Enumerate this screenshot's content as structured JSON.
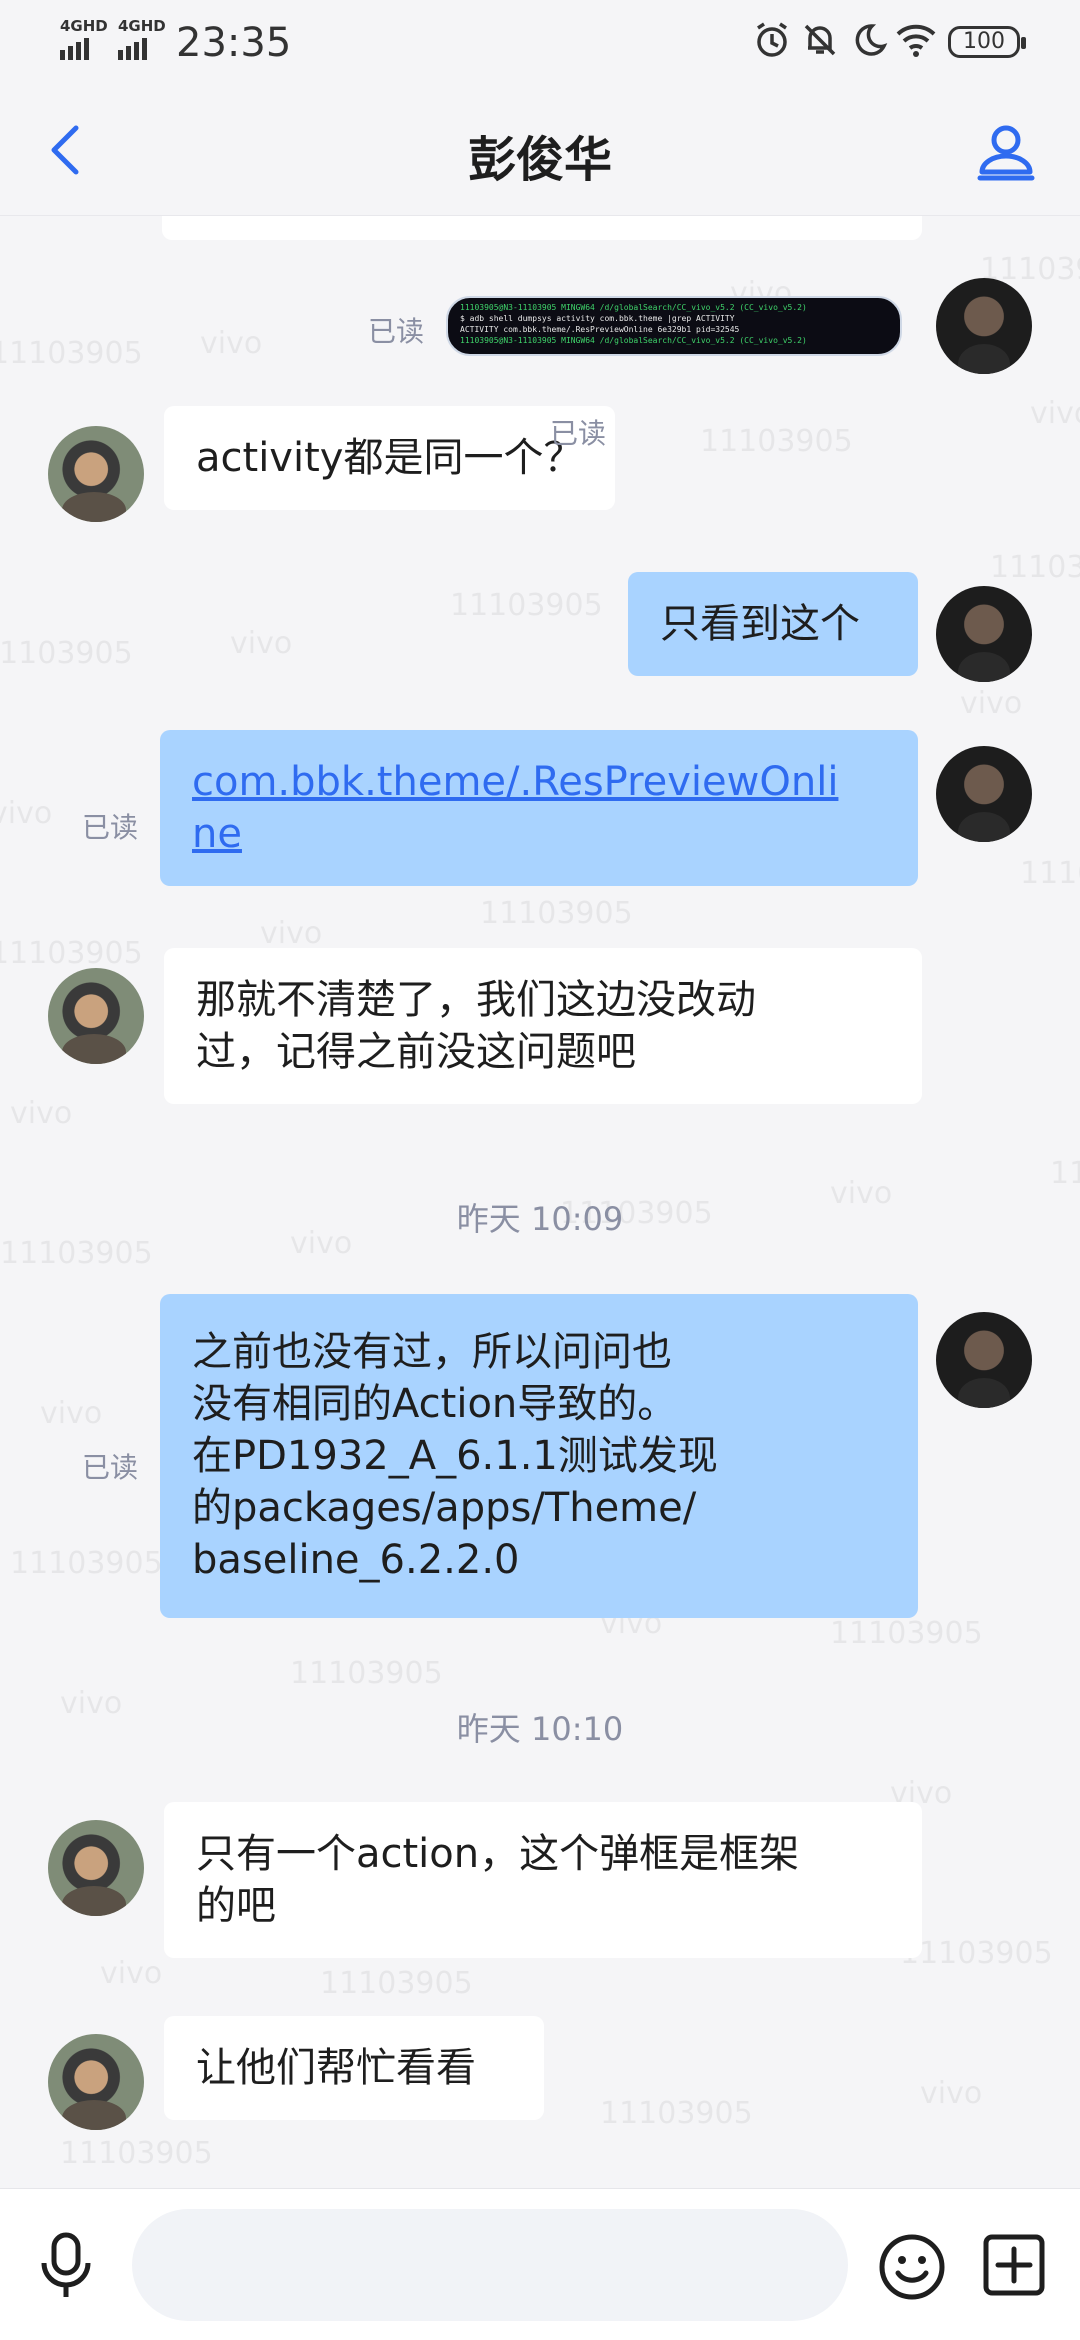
{
  "status_bar": {
    "network_1": "4GHD",
    "network_2": "4GHD",
    "time": "23:35",
    "battery": "100",
    "icons": [
      "alarm-icon",
      "mute-icon",
      "moon-icon",
      "wifi-icon"
    ]
  },
  "header": {
    "title": "彭俊华",
    "back_icon": "chevron-left-icon",
    "profile_icon": "person-icon"
  },
  "watermark": {
    "id_text": "11103905",
    "brand_text": "vivo"
  },
  "messages": [
    {
      "side": "out",
      "type": "image",
      "read": "已读",
      "image_lines": [
        "11103905@N3-11103905 MINGW64 /d/globalSearch/CC_vivo_v5.2 (CC_vivo_v5.2)",
        "$ adb shell dumpsys activity com.bbk.theme |grep ACTIVITY",
        "  ACTIVITY com.bbk.theme/.ResPreviewOnline 6e329b1 pid=32545",
        "11103905@N3-11103905 MINGW64 /d/globalSearch/CC_vivo_v5.2 (CC_vivo_v5.2)"
      ]
    },
    {
      "side": "in",
      "type": "text",
      "text": "activity都是同一个？"
    },
    {
      "side": "out",
      "type": "text",
      "read": "已读",
      "text": "只看到这个"
    },
    {
      "side": "out",
      "type": "link",
      "read": "已读",
      "lines": [
        "com.bbk.theme/.ResPreviewOnli",
        "ne"
      ]
    },
    {
      "side": "in",
      "type": "text",
      "lines": [
        "那就不清楚了，我们这边没改动",
        "过，记得之前没这问题吧"
      ]
    },
    {
      "type": "time",
      "text": "昨天 10:09"
    },
    {
      "side": "out",
      "type": "text",
      "read": "已读",
      "lines": [
        "之前也没有过，所以问问也",
        "没有相同的Action导致的。",
        "在PD1932_A_6.1.1测试发现",
        "的packages/apps/Theme/",
        "baseline_6.2.2.0"
      ]
    },
    {
      "type": "time",
      "text": "昨天 10:10"
    },
    {
      "side": "in",
      "type": "text",
      "lines": [
        "只有一个action，这个弹框是框架",
        "的吧"
      ]
    },
    {
      "side": "in",
      "type": "text",
      "text": "让他们帮忙看看"
    }
  ],
  "input_bar": {
    "mic_icon": "microphone-icon",
    "input_value": "",
    "emoji_icon": "emoji-icon",
    "plus_icon": "plus-square-icon"
  }
}
